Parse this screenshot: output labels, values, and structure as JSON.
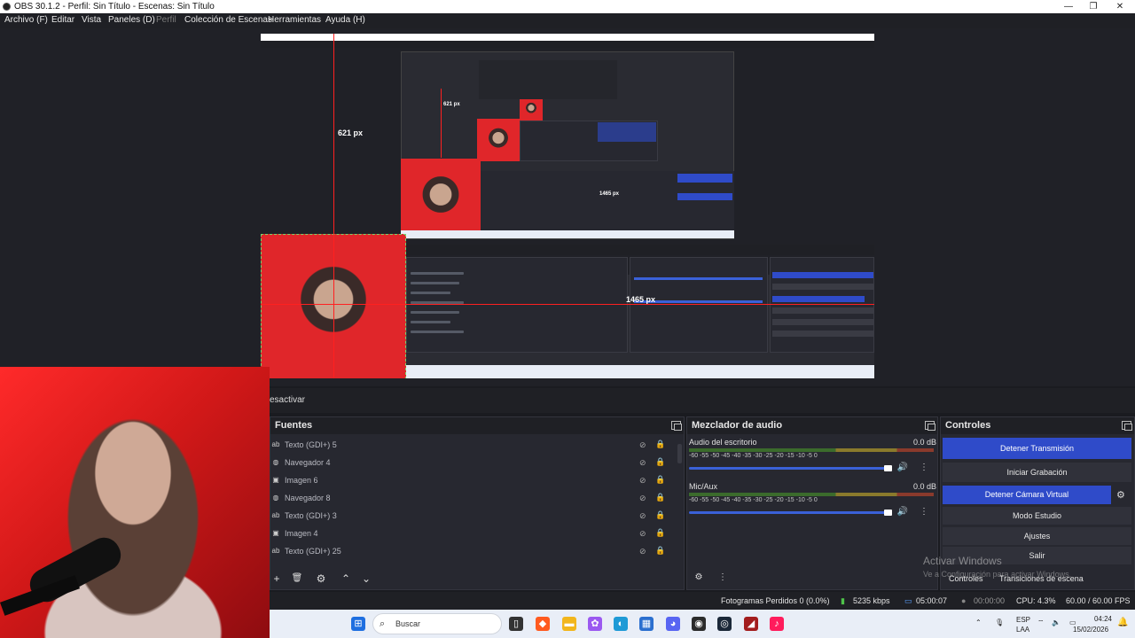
{
  "window": {
    "title": "OBS 30.1.2 - Perfil: Sin Título - Escenas: Sin Título",
    "controls": [
      "—",
      "❐",
      "✕"
    ]
  },
  "menu": [
    {
      "label": "Archivo (F)",
      "enabled": true
    },
    {
      "label": "Editar",
      "enabled": true
    },
    {
      "label": "Vista",
      "enabled": true
    },
    {
      "label": "Paneles (D)",
      "enabled": true
    },
    {
      "label": "Perfil",
      "enabled": false
    },
    {
      "label": "Colección de Escenas",
      "enabled": true
    },
    {
      "label": "Herramientas",
      "enabled": true
    },
    {
      "label": "Ayuda (H)",
      "enabled": true
    }
  ],
  "preview": {
    "measure_vertical": "621 px",
    "measure_horizontal": "1465 px",
    "nested_measure": "621 px",
    "nested_measure_h": "1465 px"
  },
  "deactivate_label": "esactivar",
  "sources": {
    "title": "Fuentes",
    "items": [
      {
        "icon": "ab",
        "label": "Texto (GDI+) 5"
      },
      {
        "icon": "◍",
        "label": "Navegador 4"
      },
      {
        "icon": "▣",
        "label": "Imagen 6"
      },
      {
        "icon": "◍",
        "label": "Navegador 8"
      },
      {
        "icon": "ab",
        "label": "Texto (GDI+) 3"
      },
      {
        "icon": "▣",
        "label": "Imagen 4"
      },
      {
        "icon": "ab",
        "label": "Texto (GDI+) 25"
      }
    ],
    "toolbar": [
      "+",
      "🗑",
      "⚙",
      "⌃",
      "⌄"
    ]
  },
  "mixer": {
    "title": "Mezclador de audio",
    "tracks": [
      {
        "name": "Audio del escritorio",
        "db": "0.0 dB",
        "ticks": "-60  -55  -50  -45  -40  -35  -30  -25  -20  -15  -10   -5   0"
      },
      {
        "name": "Mic/Aux",
        "db": "0.0 dB",
        "ticks": "-60  -55  -50  -45  -40  -35  -30  -25  -20  -15  -10   -5   0"
      }
    ]
  },
  "controls": {
    "title": "Controles",
    "buttons": [
      {
        "label": "Detener Transmisión",
        "active": true
      },
      {
        "label": "Iniciar Grabación",
        "active": false
      },
      {
        "label": "Detener Cámara Virtual",
        "active": true
      },
      {
        "label": "Modo Estudio",
        "active": false
      },
      {
        "label": "Ajustes",
        "active": false
      },
      {
        "label": "Salir",
        "active": false
      }
    ],
    "tabs": [
      "Controles",
      "Transiciones de escena"
    ]
  },
  "watermark": {
    "line1": "Activar Windows",
    "line2": "Ve a Configuración para activar Windows."
  },
  "status": {
    "dropped": "Fotogramas Perdidos 0 (0.0%)",
    "bitrate": "5235 kbps",
    "stream_time": "05:00:07",
    "rec_time": "00:00:00",
    "cpu": "CPU: 4.3%",
    "fps": "60.00 / 60.00 FPS"
  },
  "taskbar": {
    "search_placeholder": "Buscar",
    "lang": "ESP",
    "lang2": "LAA",
    "time": "04:24",
    "date": "15/02/2026",
    "colors": {
      "start": "#1f6fe0",
      "brave": "#ff5a1f",
      "explorer": "#f2b61c",
      "edge": "#1e9ad6",
      "store": "#2b6fcf",
      "discord": "#5865f2",
      "obs": "#2b2b2b",
      "steam": "#1b2838",
      "app": "#a31d1d",
      "tiktok": "#ff1c5c"
    }
  }
}
